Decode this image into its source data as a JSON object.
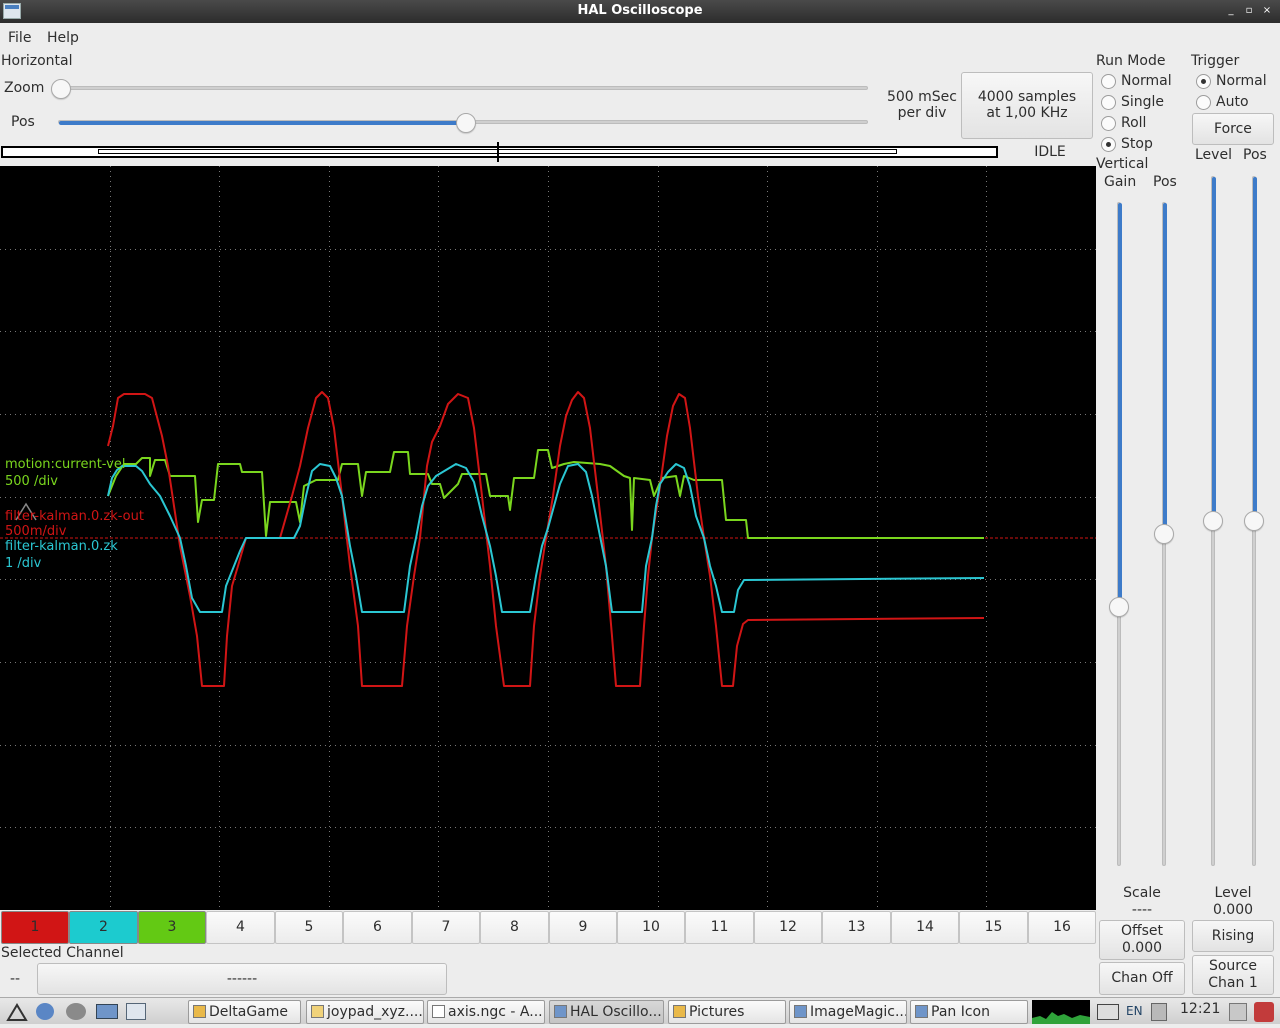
{
  "window": {
    "title": "HAL Oscilloscope"
  },
  "menu": {
    "file": "File",
    "help": "Help"
  },
  "horizontal": {
    "label": "Horizontal",
    "zoom_label": "Zoom",
    "pos_label": "Pos",
    "zoom_level": 0.0,
    "pos_level": 0.5,
    "time_per_div_line1": "500 mSec",
    "time_per_div_line2": "per div",
    "samples_line1": "4000 samples",
    "samples_line2": "at 1,00 KHz",
    "status": "IDLE"
  },
  "run_mode": {
    "label": "Run Mode",
    "options": [
      "Normal",
      "Single",
      "Roll",
      "Stop"
    ],
    "selected": "Stop"
  },
  "trigger": {
    "label": "Trigger",
    "options": [
      "Normal",
      "Auto"
    ],
    "selected": "Normal",
    "force_label": "Force",
    "level_label": "Level",
    "pos_label": "Pos",
    "level_text": "Level",
    "level_value": "0.000",
    "edge_label": "Rising",
    "source_line1": "Source",
    "source_line2": "Chan  1",
    "level_slider": 0.5,
    "pos_slider": 0.5
  },
  "vertical": {
    "label": "Vertical",
    "gain_label": "Gain",
    "pos_label": "Pos",
    "gain_slider": 0.39,
    "pos_slider": 0.5,
    "scale_label": "Scale",
    "scale_value": "----",
    "offset_label": "Offset",
    "offset_value": "0.000",
    "chan_off_label": "Chan Off"
  },
  "scope_labels": [
    {
      "name": "motion:current-vel",
      "scale": "500 /div",
      "color": "#7ad61e"
    },
    {
      "name": "filter-kalman.0.zk-out",
      "scale": "500m/div",
      "color": "#d11515"
    },
    {
      "name": "filter-kalman.0.zk",
      "scale": "1 /div",
      "color": "#2bc7d3"
    }
  ],
  "channels": [
    {
      "label": "1",
      "color": "#d11515"
    },
    {
      "label": "2",
      "color": "#1ccbcf"
    },
    {
      "label": "3",
      "color": "#63c914"
    },
    {
      "label": "4"
    },
    {
      "label": "5"
    },
    {
      "label": "6"
    },
    {
      "label": "7"
    },
    {
      "label": "8"
    },
    {
      "label": "9"
    },
    {
      "label": "10"
    },
    {
      "label": "11"
    },
    {
      "label": "12"
    },
    {
      "label": "13"
    },
    {
      "label": "14"
    },
    {
      "label": "15"
    },
    {
      "label": "16"
    }
  ],
  "selected_channel": {
    "label": "Selected Channel",
    "num": "--",
    "name": "------"
  },
  "taskbar": {
    "tasks": [
      "DeltaGame",
      "joypad_xyz....",
      "axis.ngc - A...",
      "HAL Oscillo...",
      "Pictures",
      "ImageMagic...",
      "Pan Icon"
    ],
    "lang": "EN",
    "clock": "12:21"
  },
  "colors": {
    "trace_red": "#d11515",
    "trace_cyan": "#2bc7d3",
    "trace_green": "#7ad61e",
    "accent": "#3d7bc9"
  }
}
